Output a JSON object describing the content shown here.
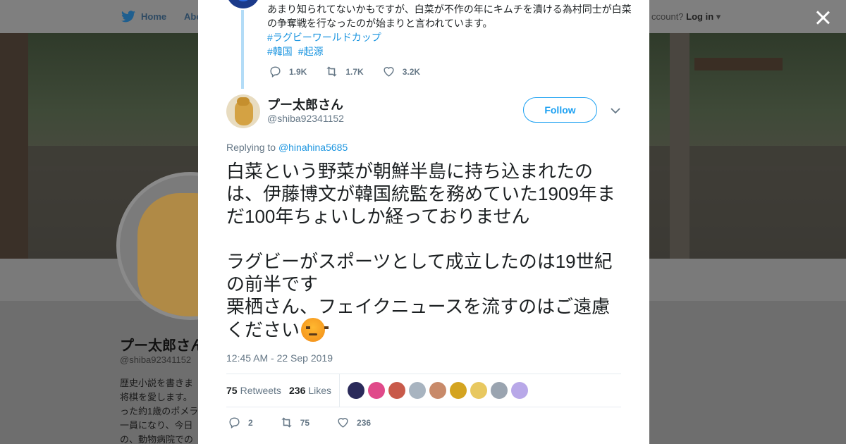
{
  "background": {
    "nav": {
      "home_label": "Home",
      "about_label": "Abo",
      "account_text": "ccount?",
      "login_label": "Log in"
    },
    "profile": {
      "name": "プー太郎さん",
      "handle": "@shiba92341152",
      "bio": "歴史小説を書きま\n将棋を愛します。\nった約1歳のポメラ\n一員になり、今日\nの、動物病院での"
    }
  },
  "ancestor_tweet": {
    "text": "あまり知られてないかもですが、白菜が不作の年にキムチを漬ける為村同士が白菜の争奪戦を行なったのが始まりと言われています。",
    "hashtags": [
      "#ラグビーワールドカップ",
      "#韓国",
      "#起源"
    ],
    "replies": "1.9K",
    "retweets": "1.7K",
    "likes": "3.2K"
  },
  "tweet": {
    "author_name": "プー太郎さん",
    "author_handle": "@shiba92341152",
    "follow_label": "Follow",
    "replying_prefix": "Replying to",
    "replying_to": "@hinahina5685",
    "paragraph1": "白菜という野菜が朝鮮半島に持ち込まれたのは、伊藤博文が韓国統監を務めていた1909年まだ100年ちょいしか経っておりません",
    "paragraph2a": "ラグビーがスポーツとして成立したのは19世紀の前半です",
    "paragraph2b": "栗栖さん、フェイクニュースを流すのはご遠慮ください",
    "emoji": "angry-face",
    "timestamp": "12:45 AM - 22 Sep 2019",
    "retweet_count": "75",
    "retweets_label": "Retweets",
    "like_count": "236",
    "likes_label": "Likes",
    "liker_colors": [
      "#2a2a5a",
      "#e04a8a",
      "#c85a4a",
      "#a8b4c0",
      "#c88a6a",
      "#d4a420",
      "#e8c860",
      "#9aa4b0",
      "#b8a8e8"
    ],
    "reply_action_count": "2",
    "retweet_action_count": "75",
    "like_action_count": "236"
  },
  "colors": {
    "accent": "#1da1f2",
    "link": "#1b95e0",
    "muted": "#657786",
    "text": "#1c2022"
  }
}
